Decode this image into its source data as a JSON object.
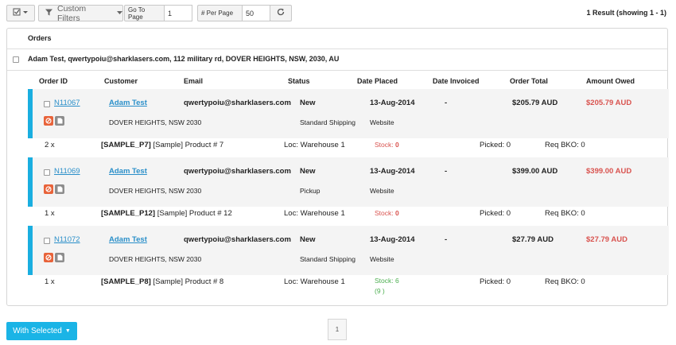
{
  "toolbar": {
    "custom_filters": "Custom Filters",
    "go_to_page_label": "Go To Page",
    "go_to_page_value": "1",
    "per_page_label": "# Per Page",
    "per_page_value": "50",
    "result_text": "1 Result (showing 1 - 1)"
  },
  "panel": {
    "title": "Orders",
    "customer_line": "Adam Test, qwertypoiu@sharklasers.com, 112 military rd, DOVER HEIGHTS, NSW, 2030, AU"
  },
  "columns": [
    "Order ID",
    "Customer",
    "Email",
    "Status",
    "Date Placed",
    "Date Invoiced",
    "Order Total",
    "Amount Owed"
  ],
  "orders": [
    {
      "id": "N11067",
      "customer": "Adam Test",
      "email": "qwertypoiu@sharklasers.com",
      "status": "New",
      "date_placed": "13-Aug-2014",
      "date_invoiced": "-",
      "total": "$205.79 AUD",
      "owed": "$205.79 AUD",
      "address": "DOVER HEIGHTS, NSW 2030",
      "shipping": "Standard Shipping",
      "source": "Website",
      "line": {
        "qty": "2 x",
        "sku": "[SAMPLE_P7]",
        "product": " [Sample] Product # 7",
        "loc": "Loc: Warehouse 1",
        "stock_label": "Stock: ",
        "stock_value": "0",
        "stock_extra": "",
        "picked": "Picked: 0",
        "bko": "Req BKO: 0"
      }
    },
    {
      "id": "N11069",
      "customer": "Adam Test",
      "email": "qwertypoiu@sharklasers.com",
      "status": "New",
      "date_placed": "13-Aug-2014",
      "date_invoiced": "-",
      "total": "$399.00 AUD",
      "owed": "$399.00 AUD",
      "address": "DOVER HEIGHTS, NSW 2030",
      "shipping": "Pickup",
      "source": "Website",
      "line": {
        "qty": "1 x",
        "sku": "[SAMPLE_P12]",
        "product": " [Sample] Product # 12",
        "loc": "Loc: Warehouse 1",
        "stock_label": "Stock: ",
        "stock_value": "0",
        "stock_extra": "",
        "picked": "Picked: 0",
        "bko": "Req BKO: 0"
      }
    },
    {
      "id": "N11072",
      "customer": "Adam Test",
      "email": "qwertypoiu@sharklasers.com",
      "status": "New",
      "date_placed": "13-Aug-2014",
      "date_invoiced": "-",
      "total": "$27.79 AUD",
      "owed": "$27.79 AUD",
      "address": "DOVER HEIGHTS, NSW 2030",
      "shipping": "Standard Shipping",
      "source": "Website",
      "line": {
        "qty": "1 x",
        "sku": "[SAMPLE_P8]",
        "product": " [Sample] Product # 8",
        "loc": "Loc: Warehouse 1",
        "stock_label": "Stock: ",
        "stock_value": "6",
        "stock_extra": "(9 )",
        "picked": "Picked: 0",
        "bko": "Req BKO: 0"
      }
    }
  ],
  "footer": {
    "with_selected": "With Selected",
    "page": "1"
  },
  "colors": {
    "accent": "#1ab4e6",
    "link": "#2a8fc9",
    "owed": "#d9534f",
    "stock_zero": "#d9534f",
    "stock_ok": "#4caf50"
  },
  "icons": [
    "checkbox-dropdown-icon",
    "filter-icon",
    "refresh-icon",
    "cancel-icon",
    "document-icon",
    "caret-down-icon"
  ]
}
